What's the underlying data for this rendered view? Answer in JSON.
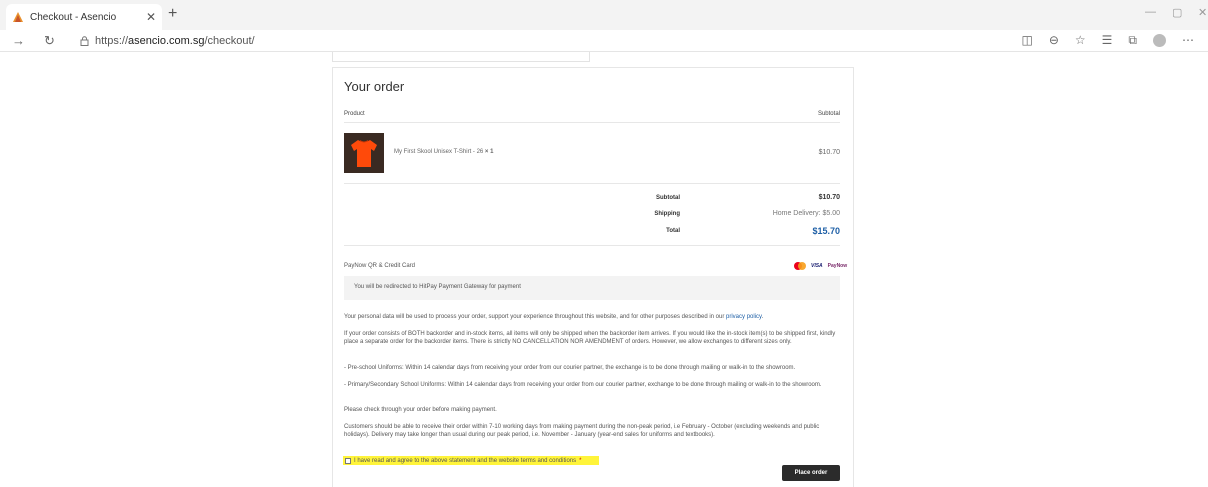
{
  "browser": {
    "tab_title": "Checkout - Asencio",
    "url_prefix": "https://",
    "url_host": "asencio.com.sg",
    "url_path": "/checkout/"
  },
  "order": {
    "heading": "Your order",
    "col_product": "Product",
    "col_subtotal": "Subtotal",
    "item_name": "My First Skool Unisex T-Shirt - 26",
    "item_qty": "× 1",
    "item_price": "$10.70",
    "subtotal_label": "Subtotal",
    "subtotal_value": "$10.70",
    "shipping_label": "Shipping",
    "shipping_value": "Home Delivery: $5.00",
    "total_label": "Total",
    "total_value": "$15.70"
  },
  "payment": {
    "method": "PayNow QR & Credit Card",
    "visa_label": "VISA",
    "paynow_label": "PayNow",
    "description": "You will be redirected to HitPay Payment Gateway for payment"
  },
  "terms": {
    "privacy_text": "Your personal data will be used to process your order, support your experience throughout this website, and for other purposes described in our",
    "privacy_link": "privacy policy",
    "backorder": "If your order consists of BOTH backorder and in-stock items, all items will only be shipped when the backorder item arrives. If you would like the in-stock item(s) to be shipped first, kindly place a separate order for the backorder items. There is strictly NO CANCELLATION NOR AMENDMENT of orders. However, we allow exchanges to different sizes only.",
    "preschool": "- Pre-school Uniforms: Within 14 calendar days from receiving your order from our courier partner, the exchange is to be done through mailing or walk-in to the showroom.",
    "primary": "- Primary/Secondary School Uniforms: Within 14 calendar days from receiving your order from our courier partner, exchange to be done through mailing or walk-in to the showroom.",
    "check": "Please check through your order before making payment.",
    "delivery": "Customers should be able to receive their order within 7-10 working days from making payment during the non-peak period, i.e February - October (excluding weekends and public holidays). Delivery may take longer than usual during our peak period, i.e. November - January (year-end sales for uniforms and textbooks).",
    "agree_label": "I have read and agree to the above statement and the website terms and conditions",
    "required_mark": "*"
  },
  "actions": {
    "place_order": "Place order"
  },
  "colors": {
    "highlight": "#fff43a",
    "price_blue": "#1e5fa6",
    "button": "#2b2b2b"
  }
}
